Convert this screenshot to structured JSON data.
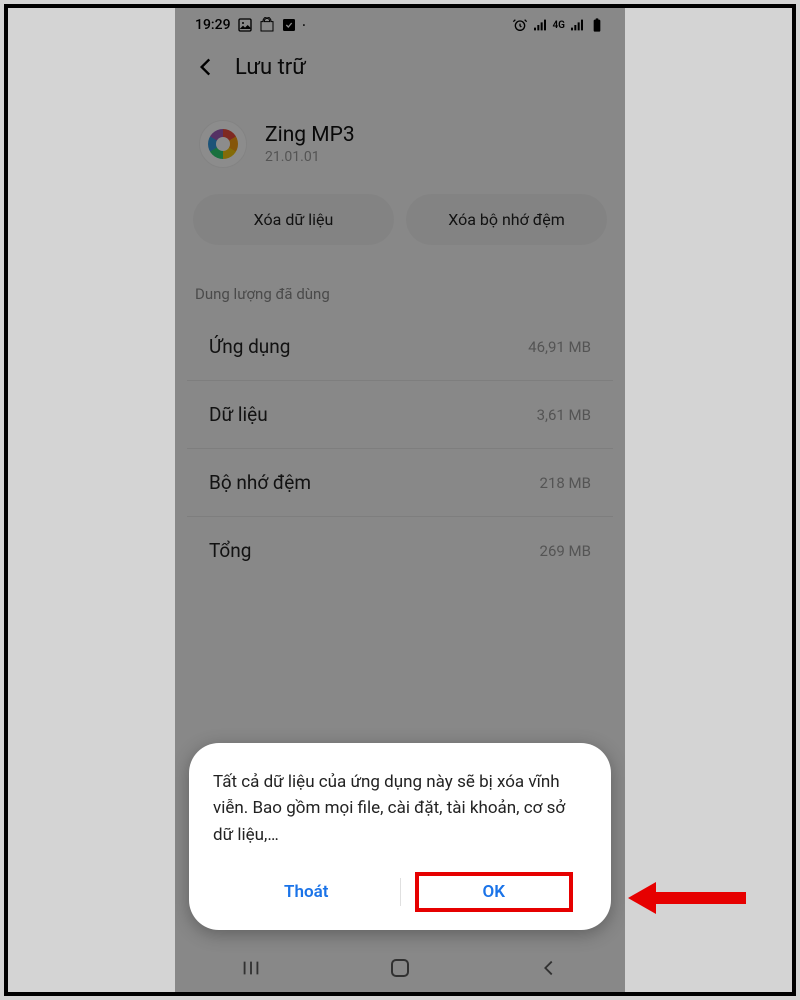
{
  "statusbar": {
    "time": "19:29",
    "network_label": "4G"
  },
  "header": {
    "title": "Lưu trữ"
  },
  "app": {
    "name": "Zing MP3",
    "version": "21.01.01"
  },
  "actions": {
    "clear_data": "Xóa dữ liệu",
    "clear_cache": "Xóa bộ nhớ đệm"
  },
  "section_label": "Dung lượng đã dùng",
  "storage": [
    {
      "label": "Ứng dụng",
      "value": "46,91 MB"
    },
    {
      "label": "Dữ liệu",
      "value": "3,61 MB"
    },
    {
      "label": "Bộ nhớ đệm",
      "value": "218 MB"
    },
    {
      "label": "Tổng",
      "value": "269 MB"
    }
  ],
  "dialog": {
    "message": "Tất cả dữ liệu của ứng dụng này sẽ bị xóa vĩnh viễn. Bao gồm mọi file, cài đặt, tài khoản, cơ sở dữ liệu,…",
    "cancel": "Thoát",
    "ok": "OK"
  },
  "colors": {
    "accent": "#1a73e8",
    "highlight": "#e60000"
  }
}
